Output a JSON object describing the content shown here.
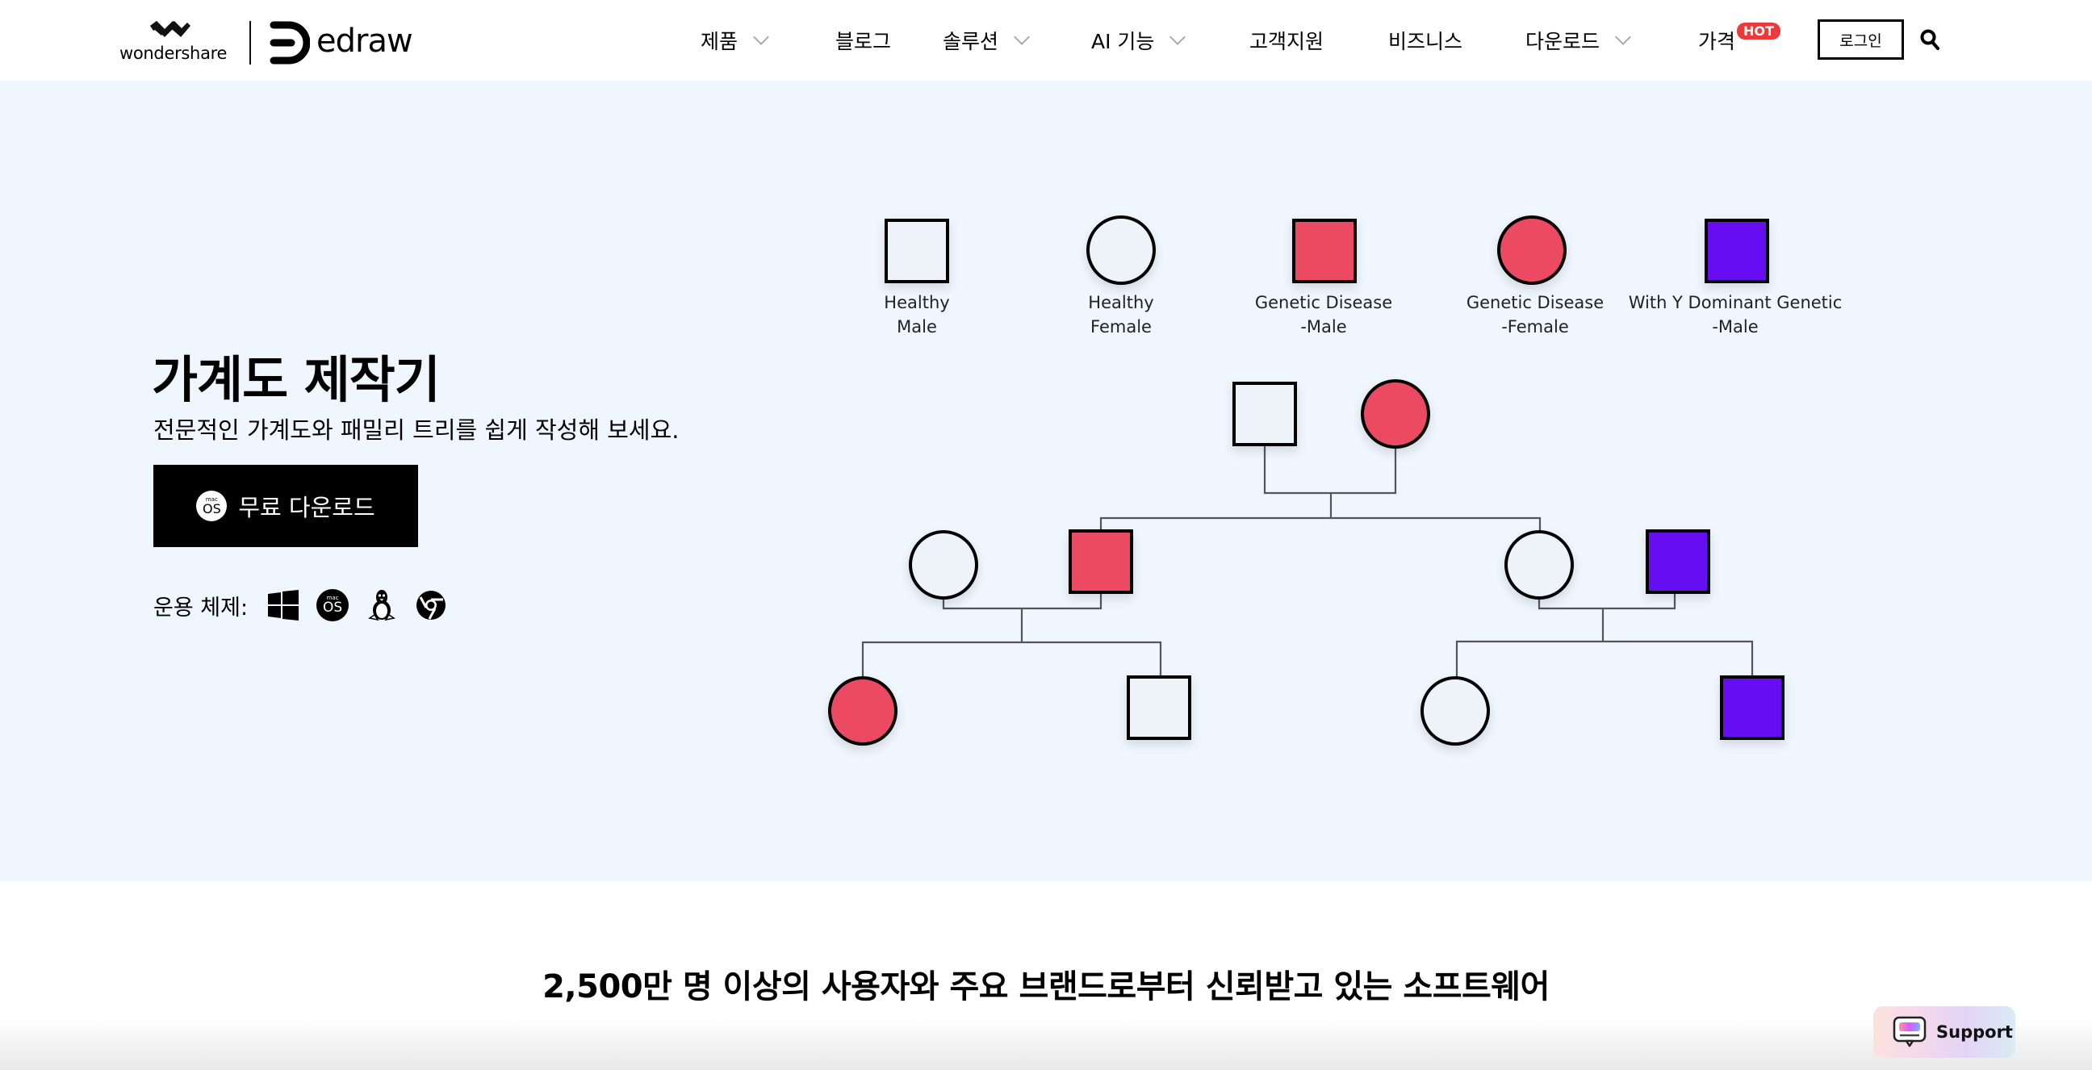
{
  "brand": {
    "company": "wondershare",
    "product": "edraw"
  },
  "nav": {
    "items": [
      {
        "label": "제품",
        "has_dropdown": true
      },
      {
        "label": "블로그",
        "has_dropdown": false
      },
      {
        "label": "솔루션",
        "has_dropdown": true
      },
      {
        "label": "AI 기능",
        "has_dropdown": true
      },
      {
        "label": "고객지원",
        "has_dropdown": false
      },
      {
        "label": "비즈니스",
        "has_dropdown": false
      },
      {
        "label": "다운로드",
        "has_dropdown": true
      },
      {
        "label": "가격",
        "has_dropdown": false,
        "badge": "HOT"
      }
    ],
    "login_label": "로그인",
    "search_icon": "search-icon",
    "badge_color": "#ec3a3a"
  },
  "hero": {
    "title": "가계도 제작기",
    "subtitle": "전문적인 가계도와 패밀리 트리를 쉽게 작성해 보세요.",
    "download_button": {
      "label": "무료 다운로드",
      "icon": "macos-icon",
      "icon_small": "mac",
      "icon_big": "OS"
    },
    "os_label": "운용 체제:",
    "os_icons": [
      "windows-icon",
      "macos-icon",
      "linux-icon",
      "chrome-icon"
    ],
    "background": "#eff6fe"
  },
  "pedigree": {
    "colors": {
      "healthy": "#eef3fa",
      "disease": "#ec4a62",
      "y_dominant": "#6610f2",
      "stroke": "#000000",
      "connector": "#555555"
    },
    "legend": [
      {
        "shape": "square",
        "status": "healthy",
        "line1": "Healthy",
        "line2": "Male"
      },
      {
        "shape": "circle",
        "status": "healthy",
        "line1": "Healthy",
        "line2": "Female"
      },
      {
        "shape": "square",
        "status": "disease",
        "line1": "Genetic Disease",
        "line2": "-Male"
      },
      {
        "shape": "circle",
        "status": "disease",
        "line1": "Genetic Disease",
        "line2": "-Female"
      },
      {
        "shape": "square",
        "status": "y_dominant",
        "line1": "With Y Dominant Genetic",
        "line2": "-Male"
      }
    ],
    "members": [
      {
        "id": "gf",
        "shape": "square",
        "status": "healthy",
        "generation": 1
      },
      {
        "id": "gm",
        "shape": "circle",
        "status": "disease",
        "generation": 1
      },
      {
        "id": "p1w",
        "shape": "circle",
        "status": "healthy",
        "generation": 2
      },
      {
        "id": "p1h",
        "shape": "square",
        "status": "disease",
        "generation": 2
      },
      {
        "id": "p2w",
        "shape": "circle",
        "status": "healthy",
        "generation": 2
      },
      {
        "id": "p2h",
        "shape": "square",
        "status": "y_dominant",
        "generation": 2
      },
      {
        "id": "c1",
        "shape": "circle",
        "status": "disease",
        "generation": 3
      },
      {
        "id": "c2",
        "shape": "square",
        "status": "healthy",
        "generation": 3
      },
      {
        "id": "c3",
        "shape": "circle",
        "status": "healthy",
        "generation": 3
      },
      {
        "id": "c4",
        "shape": "square",
        "status": "y_dominant",
        "generation": 3
      }
    ]
  },
  "trust": {
    "title": "2,500만 명 이상의 사용자와 주요 브랜드로부터 신뢰받고 있는 소프트웨어"
  },
  "support": {
    "label": "Support",
    "icon": "chat-support-icon"
  }
}
